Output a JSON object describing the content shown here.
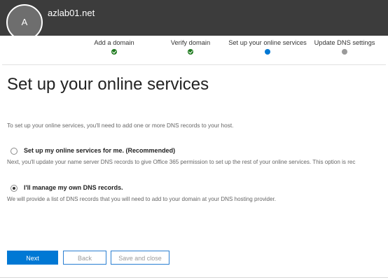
{
  "header": {
    "avatar_initial": "A",
    "tenant_name": "azlab01.net"
  },
  "steps": [
    {
      "label": "Add a domain",
      "state": "done"
    },
    {
      "label": "Verify domain",
      "state": "done"
    },
    {
      "label": "Set up your online services",
      "state": "current"
    },
    {
      "label": "Update DNS settings",
      "state": "todo"
    }
  ],
  "main": {
    "title": "Set up your online services",
    "intro": "To set up your online services, you'll need to add one or more DNS records to your host.",
    "options": [
      {
        "label": "Set up my online services for me. (Recommended)",
        "description": "Next, you'll update your name server DNS records to give Office 365 permission to set up the rest of your online services. This option is rec",
        "selected": false
      },
      {
        "label": "I'll manage my own DNS records.",
        "description": "We will provide a list of DNS records that you will need to add to your domain at your DNS hosting provider.",
        "selected": true
      }
    ]
  },
  "actions": {
    "next_label": "Next",
    "back_label": "Back",
    "save_close_label": "Save and close"
  },
  "colors": {
    "header_bg": "#3c3c3c",
    "accent": "#0078d4",
    "done": "#1e7a1e",
    "pending": "#9a9a9a"
  }
}
